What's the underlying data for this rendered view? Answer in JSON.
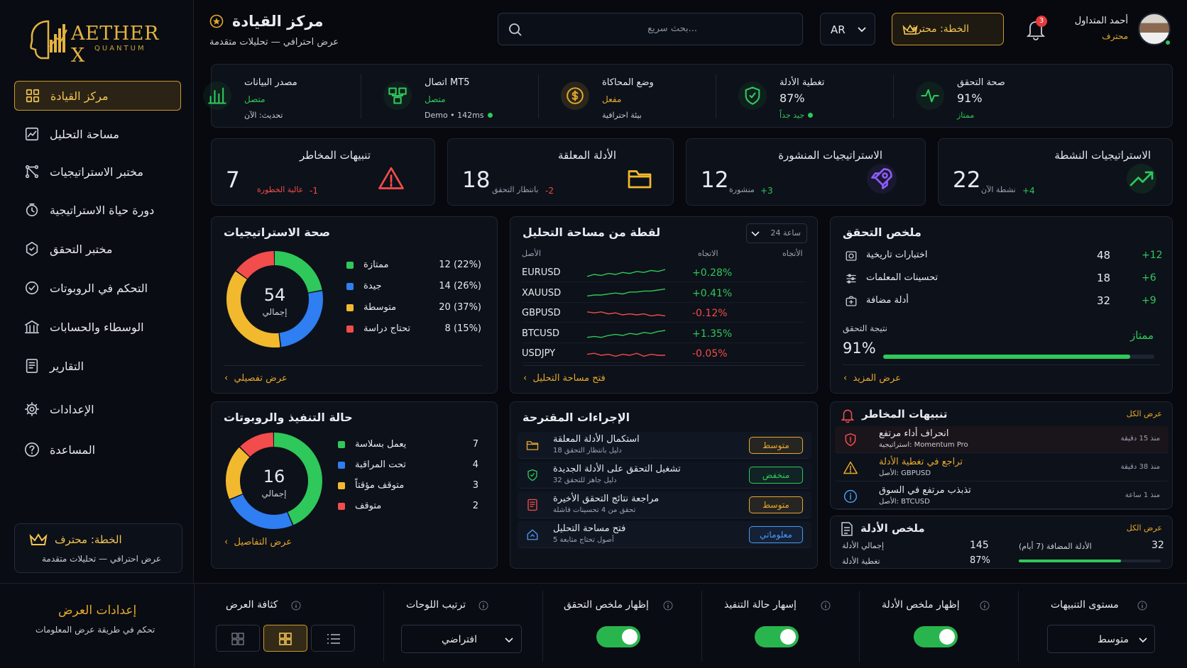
{
  "app": {
    "logo_word": "AETHER X",
    "logo_sub": "QUANTUM"
  },
  "nav": [
    {
      "label": "مركز القيادة",
      "icon": "grid-icon"
    },
    {
      "label": "مساحة التحليل",
      "icon": "chart-icon"
    },
    {
      "label": "مختبر الاستراتيجيات",
      "icon": "strategy-icon"
    },
    {
      "label": "دورة حياة الاستراتيجية",
      "icon": "lifecycle-icon"
    },
    {
      "label": "مختبر التحقق",
      "icon": "validation-icon"
    },
    {
      "label": "التحكم في الروبوتات",
      "icon": "robot-icon"
    },
    {
      "label": "الوسطاء والحسابات",
      "icon": "bank-icon"
    },
    {
      "label": "التقارير",
      "icon": "report-icon"
    },
    {
      "label": "الإعدادات",
      "icon": "gear-icon"
    },
    {
      "label": "المساعدة",
      "icon": "help-icon"
    }
  ],
  "plan": {
    "title": "الخطة: محترف",
    "subtitle": "عرض احترافي — تحليلات متقدمة"
  },
  "header": {
    "title": "مركز القيادة",
    "subtitle": "عرض احترافي — تحليلات متقدمة",
    "search_placeholder": "بحث سريع...",
    "lang": "AR",
    "plan_button": "الخطة: محترف",
    "notif_count": "3",
    "user_name": "أحمد المتداول",
    "user_role": "محترف"
  },
  "status": [
    {
      "title": "صحة التحقق",
      "value": "91%",
      "note": "ممتاز",
      "icon": "pulse-icon"
    },
    {
      "title": "تغطية الأدلة",
      "value": "87%",
      "note": "جيد جداً",
      "icon": "shield-icon"
    },
    {
      "title": "وضع المحاكاة",
      "value": "مفعل",
      "note": "بيئة احترافية",
      "icon": "coin-icon"
    },
    {
      "title": "اتصال MT5",
      "value": "متصل",
      "note": "Demo • 142ms",
      "icon": "network-icon"
    },
    {
      "title": "مصدر البيانات",
      "value": "متصل",
      "note": "تحديث: الآن",
      "icon": "bars-icon"
    }
  ],
  "kpis": [
    {
      "title": "الاستراتيجيات النشطة",
      "value": "22",
      "delta": "+4",
      "sub": "نشطة الآن",
      "icon": "trend-up-icon"
    },
    {
      "title": "الاستراتيجيات المنشورة",
      "value": "12",
      "delta": "+3",
      "sub": "منشورة",
      "icon": "rocket-icon"
    },
    {
      "title": "الأدلة المعلقة",
      "value": "18",
      "delta": "-2",
      "sub": "بانتظار التحقق",
      "icon": "folder-icon"
    },
    {
      "title": "تنبيهات المخاطر",
      "value": "7",
      "delta": "-1",
      "sub": "عالية الخطورة",
      "icon": "warning-icon"
    }
  ],
  "health": {
    "title": "صحة الاستراتيجيات",
    "total": "54",
    "total_label": "إجمالي",
    "link": "عرض تفصيلي",
    "rows": [
      {
        "label": "ممتازة",
        "value": "12 (22%)",
        "color": "#2fc85b",
        "n": 12
      },
      {
        "label": "جيدة",
        "value": "14 (26%)",
        "color": "#2f7ef2",
        "n": 14
      },
      {
        "label": "متوسطة",
        "value": "20 (37%)",
        "color": "#f2b92f",
        "n": 20
      },
      {
        "label": "تحتاج دراسة",
        "value": "8 (15%)",
        "color": "#f24c4c",
        "n": 8
      }
    ]
  },
  "snapshot": {
    "title": "لقطة من مساحة التحليل",
    "range": "24 ساعة",
    "col_asset": "الأصل",
    "col_change": "الاتجاه",
    "col_trend": "الأتجاه",
    "link": "فتح مساحة التحليل",
    "rows": [
      {
        "asset": "EURUSD",
        "change": "+0.28%",
        "up": true
      },
      {
        "asset": "XAUUSD",
        "change": "+0.41%",
        "up": true
      },
      {
        "asset": "GBPUSD",
        "change": "-0.12%",
        "up": false
      },
      {
        "asset": "BTCUSD",
        "change": "+1.35%",
        "up": true
      },
      {
        "asset": "USDJPY",
        "change": "-0.05%",
        "up": false
      }
    ]
  },
  "validation": {
    "title": "ملخص التحقق",
    "score_label": "نتيجة التحقق",
    "score": "91%",
    "score_value": 0.91,
    "grade": "ممتاز",
    "link": "عرض المزيد",
    "rows": [
      {
        "label": "اختبارات تاريخية",
        "value": "48",
        "delta": "+12"
      },
      {
        "label": "تحسينات المعلمات",
        "value": "18",
        "delta": "+6"
      },
      {
        "label": "أدلة مضافة",
        "value": "32",
        "delta": "+9"
      }
    ]
  },
  "execution": {
    "title": "حالة التنفيذ والروبوتات",
    "total": "16",
    "total_label": "إجمالي",
    "link": "عرض التفاصيل",
    "rows": [
      {
        "label": "يعمل بسلاسة",
        "value": "7",
        "color": "#2fc85b",
        "n": 7
      },
      {
        "label": "تحت المراقبة",
        "value": "4",
        "color": "#2f7ef2",
        "n": 4
      },
      {
        "label": "متوقف مؤقتاً",
        "value": "3",
        "color": "#f2b92f",
        "n": 3
      },
      {
        "label": "متوقف",
        "value": "2",
        "color": "#f24c4c",
        "n": 2
      }
    ]
  },
  "actions": {
    "title": "الإجراءات المقترحة",
    "rows": [
      {
        "title": "استكمال الأدلة المعلقة",
        "sub": "18 دليل بانتظار التحقق",
        "badge": "متوسط",
        "kind": "gold",
        "icon": "folder-icon"
      },
      {
        "title": "تشغيل التحقق على الأدلة الجديدة",
        "sub": "32 دليل جاهز للتحقق",
        "badge": "منخفض",
        "kind": "green",
        "icon": "shield-icon"
      },
      {
        "title": "مراجعة نتائج التحقق الأخيرة",
        "sub": "تحقق من 4 تحسينات فاشلة",
        "badge": "متوسط",
        "kind": "gold",
        "icon": "report-icon"
      },
      {
        "title": "فتح مساحة التحليل",
        "sub": "5 أصول تحتاج متابعة",
        "badge": "معلوماتي",
        "kind": "blue",
        "icon": "home-icon"
      }
    ]
  },
  "risk": {
    "title": "تنبيهات المخاطر",
    "view_all": "عرض الكل",
    "rows": [
      {
        "title": "انحراف أداء مرتفع",
        "sub": "استراتيجية: Momentum Pro",
        "time": "منذ 15 دقيقة",
        "kind": "red"
      },
      {
        "title": "تراجع في تغطية الأدلة",
        "sub": "الأصل: GBPUSD",
        "time": "منذ 38 دقيقة",
        "kind": "gold"
      },
      {
        "title": "تذبذب مرتفع في السوق",
        "sub": "الأصل: BTCUSD",
        "time": "منذ 1 ساعة",
        "kind": "blue"
      }
    ]
  },
  "evidence": {
    "title": "ملخص الأدلة",
    "view_all": "عرض الكل",
    "total_label": "إجمالي الأدلة",
    "total": "145",
    "coverage_label": "تغطية الأدلة",
    "coverage": "87%",
    "added_label": "الأدلة المضافة (7 أيام)",
    "added": "32",
    "added_fill": 0.72
  },
  "footer": {
    "title": "إعدادات العرض",
    "subtitle": "تحكم في طريقة عرض المعلومات",
    "density_label": "كثافة العرض",
    "order_label": "ترتيب اللوحات",
    "order_value": "افتراضي",
    "show_validation": "إظهار ملخص التحقق",
    "show_execution": "إسهار حالة التنفيذ",
    "show_evidence": "إظهار ملخص الأدلة",
    "alert_level_label": "مستوى التنبيهات",
    "alert_level_value": "متوسط"
  },
  "colors": {
    "gold": "#e6a92c",
    "green": "#2fc85b",
    "red": "#f24c4c",
    "blue": "#2f7ef2",
    "bg": "#07090e"
  }
}
